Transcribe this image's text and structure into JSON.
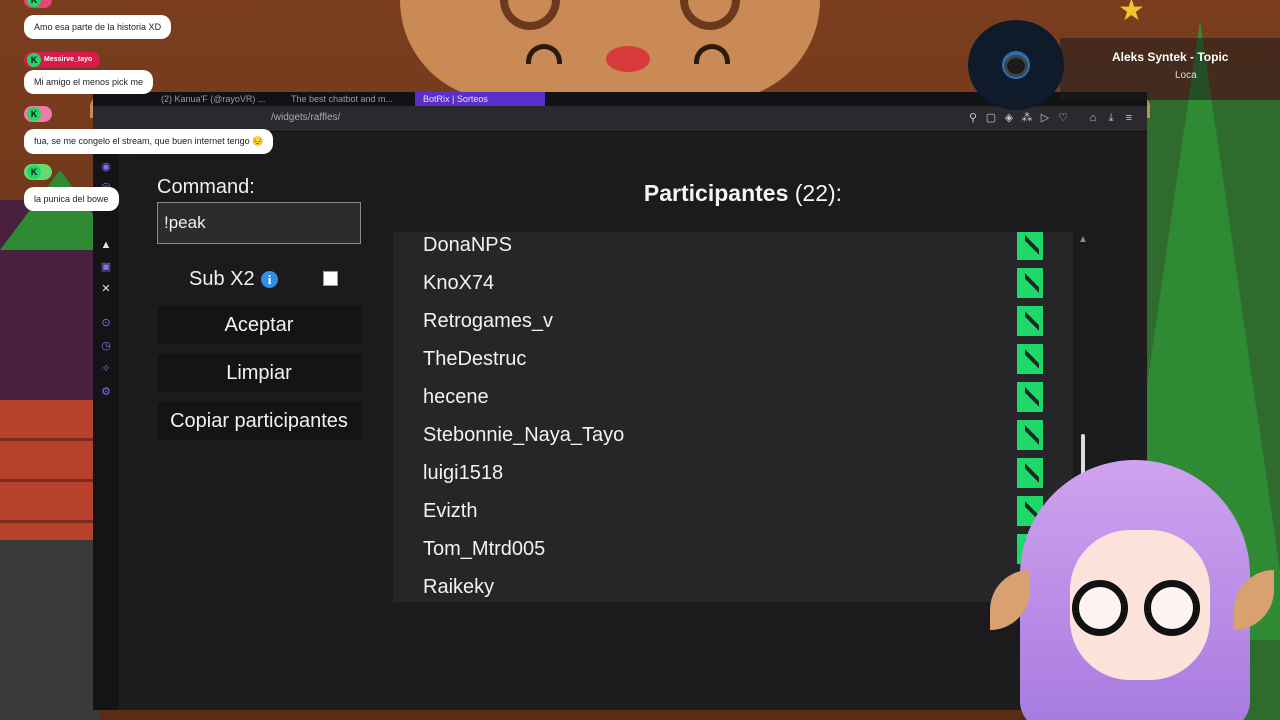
{
  "browser": {
    "tabs": [
      {
        "label": "(2) Kanua'F (@rayoVR) ..."
      },
      {
        "label": "The best chatbot and m..."
      },
      {
        "label": "BotRix | Sorteos"
      }
    ],
    "url": "/widgets/raffles/"
  },
  "form": {
    "command_label": "Command:",
    "command_value": "!peak",
    "sub_label": "Sub X2",
    "sub_info_icon": "i",
    "sub_checked": false,
    "accept_button": "Aceptar",
    "clear_button": "Limpiar",
    "copy_button": "Copiar participantes"
  },
  "participants": {
    "title": "Participantes",
    "count": "(22):",
    "list": [
      "DonaNPS",
      "KnoX74",
      "Retrogames_v",
      "TheDestruc",
      "hecene",
      "Stebonnie_Naya_Tayo",
      "luigi1518",
      "Evizth",
      "Tom_Mtrd005",
      "Raikeky"
    ]
  },
  "chat": [
    {
      "user": "",
      "message": "Amo esa parte de la historia XD",
      "user_color": "#e8457a"
    },
    {
      "user": "Messirve_tayo",
      "message": "Mi amigo el menos pick me",
      "user_color": "#d81b4a"
    },
    {
      "user": "",
      "message": "fua, se me congelo el stream, que buen internet tengo 😔",
      "user_color": "#f07aa8"
    },
    {
      "user": "",
      "message": "la punica del bowe",
      "user_color": "#6ad86a"
    }
  ],
  "music": {
    "title": "Aleks Syntek - Topic",
    "artist": "Loca"
  },
  "colors": {
    "kick_green": "#1fd86a",
    "opera_purple": "#8a6cf0",
    "info_blue": "#2f8ee6"
  }
}
